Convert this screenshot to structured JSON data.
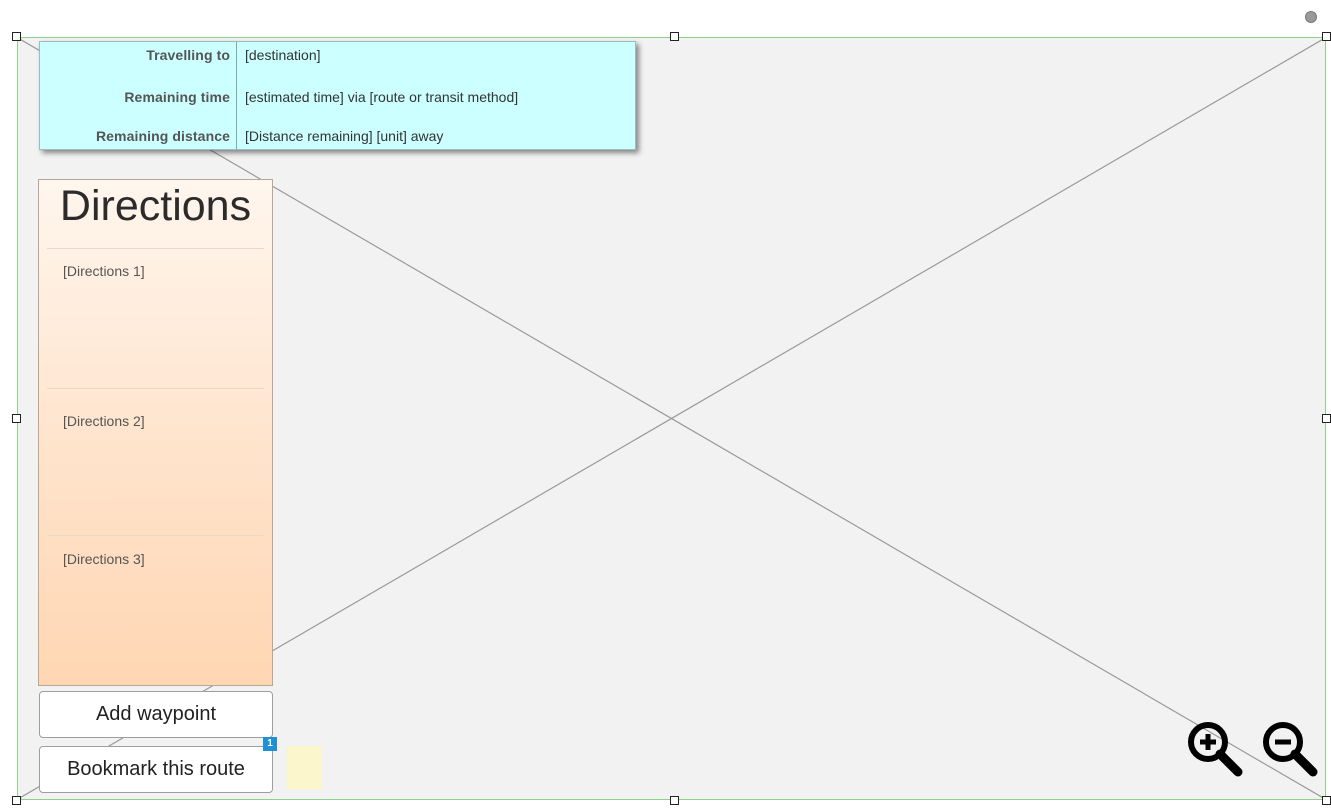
{
  "trip": {
    "travelling_label": "Travelling to",
    "travelling_value": "[destination]",
    "time_label": "Remaining time",
    "time_value": "[estimated time] via [route or transit method]",
    "distance_label": "Remaining distance",
    "distance_value": "[Distance remaining] [unit] away"
  },
  "directions": {
    "title": "Directions",
    "items": [
      {
        "label": "[Directions 1]"
      },
      {
        "label": "[Directions 2]"
      },
      {
        "label": "[Directions 3]"
      }
    ]
  },
  "buttons": {
    "add_waypoint": "Add waypoint",
    "bookmark": "Bookmark this route",
    "bookmark_badge": "1"
  },
  "icons": {
    "zoom_in": "zoom-in-icon",
    "zoom_out": "zoom-out-icon"
  },
  "colors": {
    "trip_panel_bg": "#ccffff",
    "directions_gradient_top": "#fff6ee",
    "directions_gradient_bottom": "#ffd6b3",
    "badge": "#1e90d6",
    "map_bg": "#f2f2f2",
    "selection_border": "#8fd18a"
  }
}
